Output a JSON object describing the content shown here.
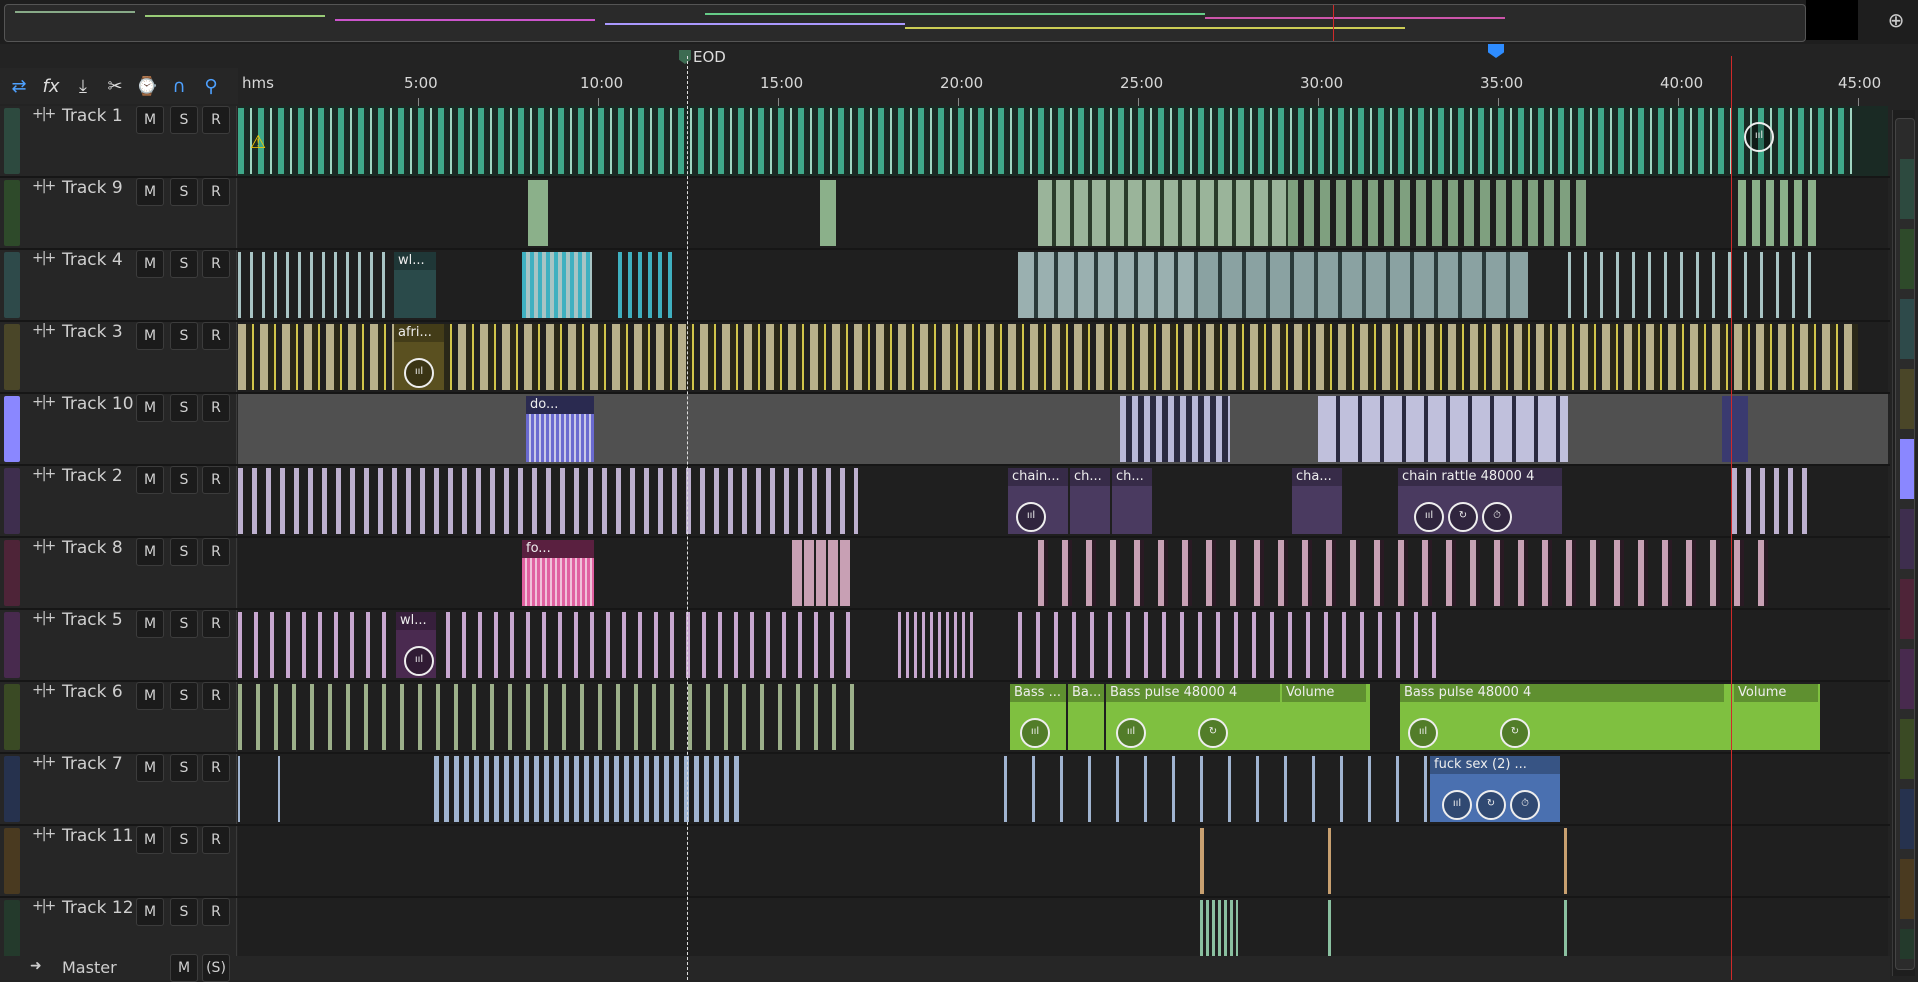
{
  "ruler": {
    "unit": "hms",
    "marks": [
      "5:00",
      "10:00",
      "15:00",
      "20:00",
      "25:00",
      "30:00",
      "35:00",
      "40:00",
      "45:00"
    ],
    "eod_label": "EOD"
  },
  "toolbar": {
    "icons": [
      "swap-icon",
      "fx-icon",
      "move-icon",
      "trim-icon",
      "stretch-icon",
      "magnet-icon",
      "pin-icon"
    ],
    "fx_label": "fx"
  },
  "colors": {
    "track_1": "#2d8a6b",
    "track_9": "#3a5a38",
    "track_4": "#355a5a",
    "track_3": "#6f6738",
    "track_10": "#8a87ff",
    "track_2": "#5b456e",
    "track_8": "#7a3a5a",
    "track_5": "#6d3f72",
    "track_6": "#5b7a2d",
    "track_7": "#344a72",
    "track_11": "#7a5a2d",
    "track_12": "#2d5a3f",
    "playhead": "#2e8cff",
    "time_cursor": "#d02a2a"
  },
  "track_buttons": {
    "mute": "M",
    "solo": "S",
    "record": "R"
  },
  "tracks": [
    {
      "name": "Track 1"
    },
    {
      "name": "Track 9"
    },
    {
      "name": "Track 4"
    },
    {
      "name": "Track 3"
    },
    {
      "name": "Track 10"
    },
    {
      "name": "Track 2"
    },
    {
      "name": "Track 8"
    },
    {
      "name": "Track 5"
    },
    {
      "name": "Track 6"
    },
    {
      "name": "Track 7"
    },
    {
      "name": "Track 11"
    },
    {
      "name": "Track 12"
    }
  ],
  "clip_labels": {
    "track_4_a": "wl...",
    "track_3_a": "afri...",
    "track_10_a": "do...",
    "track_2_a": "chain...",
    "track_2_b": "ch...",
    "track_2_c": "ch...",
    "track_2_d": "cha...",
    "track_2_e": "chain rattle 48000 4",
    "track_8_a": "fo...",
    "track_5_a": "wl...",
    "track_6_a": "Bass ...",
    "track_6_b": "Ba...",
    "track_6_c": "Bass pulse 48000 4",
    "track_6_c_extra": "Volume",
    "track_6_d": "Bass pulse 48000 4",
    "track_6_d_extra": "Volume",
    "track_7_a": "fuck sex (2) ..."
  },
  "master": {
    "name": "Master",
    "mute": "M",
    "solo": "(S)"
  }
}
